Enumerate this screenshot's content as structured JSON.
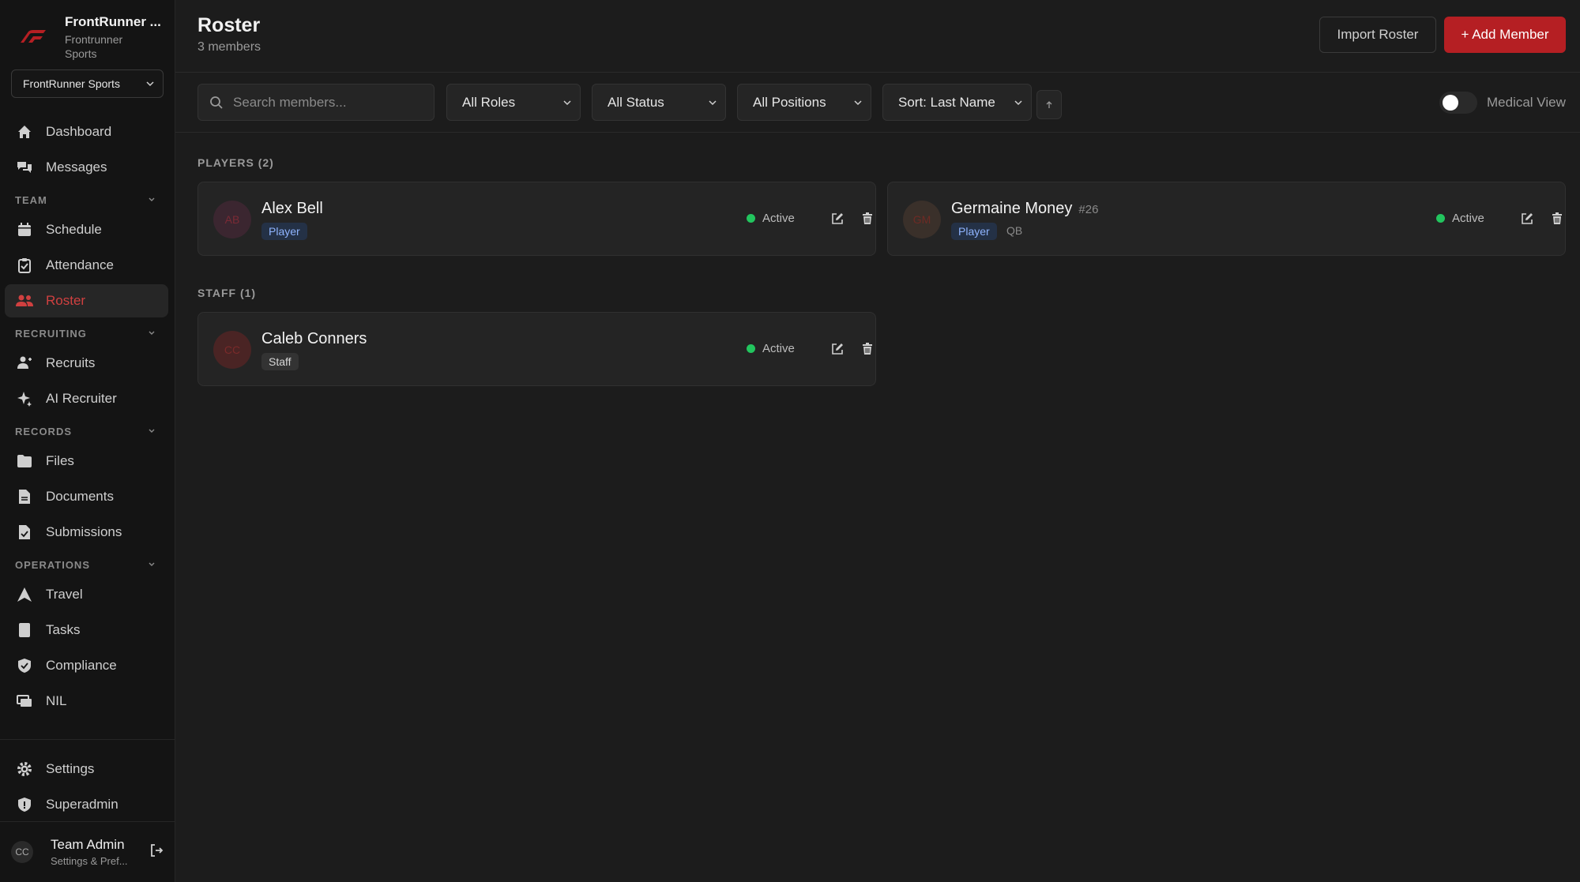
{
  "brand": {
    "name": "FrontRunner ...",
    "subtitle": "Frontrunner Sports",
    "org_select": "FrontRunner Sports"
  },
  "nav": {
    "dashboard": "Dashboard",
    "messages": "Messages",
    "team_section": "TEAM",
    "schedule": "Schedule",
    "attendance": "Attendance",
    "roster": "Roster",
    "recruiting_section": "RECRUITING",
    "recruits": "Recruits",
    "ai_recruiter": "AI Recruiter",
    "records_section": "RECORDS",
    "files": "Files",
    "documents": "Documents",
    "submissions": "Submissions",
    "operations_section": "OPERATIONS",
    "travel": "Travel",
    "tasks": "Tasks",
    "compliance": "Compliance",
    "nil": "NIL",
    "settings": "Settings",
    "superadmin": "Superadmin"
  },
  "user": {
    "initials": "CC",
    "name": "Team Admin",
    "subtitle": "Settings & Pref..."
  },
  "header": {
    "title": "Roster",
    "subtitle": "3 members",
    "import_label": "Import Roster",
    "add_label": "+ Add Member"
  },
  "toolbar": {
    "search_placeholder": "Search members...",
    "roles": "All Roles",
    "status": "All Status",
    "positions": "All Positions",
    "sort": "Sort: Last Name",
    "medical_view": "Medical View",
    "medical_view_on": false
  },
  "groups": {
    "players_label": "PLAYERS (2)",
    "staff_label": "STAFF (1)"
  },
  "members": {
    "alex": {
      "initials": "AB",
      "name": "Alex Bell",
      "role": "Player",
      "status": "Active"
    },
    "germaine": {
      "initials": "GM",
      "name": "Germaine Money",
      "number": "#26",
      "role": "Player",
      "position": "QB",
      "status": "Active"
    },
    "caleb": {
      "initials": "CC",
      "name": "Caleb Conners",
      "role": "Staff",
      "status": "Active"
    }
  },
  "colors": {
    "accent": "#b51f23",
    "active_nav": "#d04040",
    "status_active": "#22c55e"
  }
}
